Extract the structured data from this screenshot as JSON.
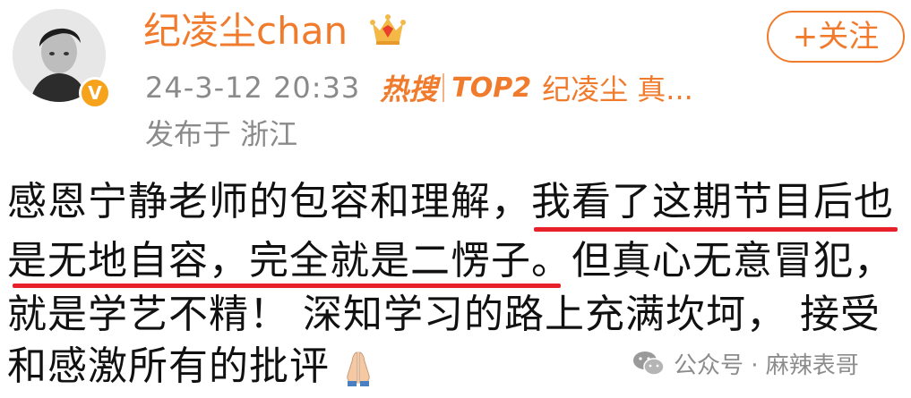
{
  "user": {
    "name": "纪凌尘chan",
    "avatar_icon": "user-avatar-photo",
    "verified_icon": "verified-v-badge",
    "vip_icon": "crown-vip-icon"
  },
  "follow_button": {
    "label": "+关注"
  },
  "meta": {
    "timestamp": "24-3-12 20:33",
    "hot_label": "热搜",
    "top_label": "TOP2",
    "hot_topic": "纪凌尘 真...",
    "location": "发布于 浙江"
  },
  "post": {
    "line1_a": "感恩宁静老师的包容和理解，",
    "line1_b": "我看了这期节目后也",
    "line2_a": "是无地自容，完全就是二愣子",
    "line2_b": "。但真心无意冒犯，",
    "line3": "就是学艺不精！ 深知学习的路上充满坎坷， 接受",
    "line4": "和感激所有的批评",
    "emoji_icon": "folded-hands-emoji"
  },
  "watermark": {
    "text": "公众号 · 麻辣表哥",
    "icon": "wechat-icon"
  },
  "colors": {
    "accent": "#f07b2c",
    "gray_text": "#8a8a8a",
    "underline": "#e8202a",
    "body_text": "#111111"
  }
}
